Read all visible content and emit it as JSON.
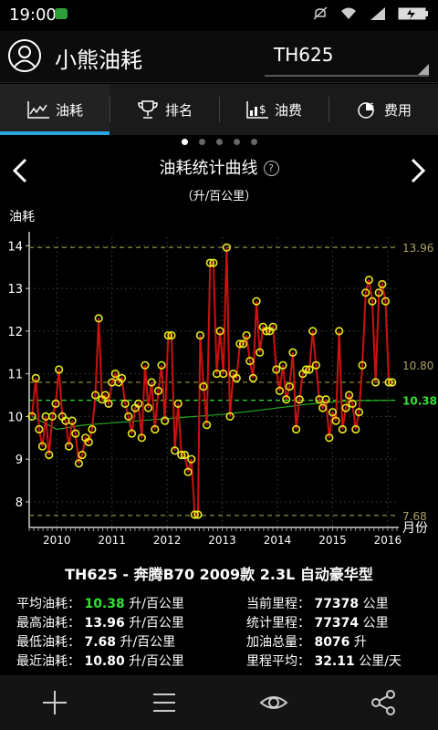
{
  "status": {
    "time": "19:00"
  },
  "app": {
    "title": "小熊油耗",
    "vehicle": "TH625"
  },
  "tabs": [
    {
      "label": "油耗",
      "icon": "consumption-chart-icon",
      "active": true
    },
    {
      "label": "排名",
      "icon": "trophy-icon",
      "active": false
    },
    {
      "label": "油费",
      "icon": "fuel-cost-icon",
      "active": false
    },
    {
      "label": "费用",
      "icon": "expense-pie-icon",
      "active": false
    }
  ],
  "pager": {
    "count": 5,
    "active": 0
  },
  "chart_header": {
    "title": "油耗统计曲线",
    "help": "?",
    "unit": "（升/百公里）"
  },
  "chart_data": {
    "type": "line",
    "ylabel": "油耗",
    "xlabel": "月份",
    "ylim": [
      7.4,
      14.2
    ],
    "yticks": [
      8,
      9,
      10,
      11,
      12,
      13,
      14
    ],
    "xlim": [
      2009.5,
      2016.2
    ],
    "xticks": [
      2010,
      2011,
      2012,
      2013,
      2014,
      2015,
      2016
    ],
    "reference_lines": [
      {
        "label": "13.96",
        "value": 13.96,
        "color": "#8a8a3a"
      },
      {
        "label": "10.80",
        "value": 10.8,
        "color": "#8a8a3a"
      },
      {
        "label": "10.38",
        "value": 10.38,
        "color": "#33e233"
      },
      {
        "label": "7.68",
        "value": 7.68,
        "color": "#8a8a3a"
      }
    ],
    "series": [
      {
        "role": "fuel-consumption",
        "color": "#cc1111",
        "marker_color": "#e8e81a",
        "x": [
          2009.55,
          2009.62,
          2009.68,
          2009.74,
          2009.8,
          2009.86,
          2009.92,
          2009.98,
          2010.04,
          2010.1,
          2010.16,
          2010.22,
          2010.28,
          2010.34,
          2010.4,
          2010.46,
          2010.52,
          2010.58,
          2010.64,
          2010.7,
          2010.76,
          2010.82,
          2010.88,
          2010.94,
          2011.0,
          2011.06,
          2011.12,
          2011.18,
          2011.24,
          2011.3,
          2011.36,
          2011.42,
          2011.48,
          2011.54,
          2011.6,
          2011.66,
          2011.72,
          2011.78,
          2011.84,
          2011.9,
          2011.96,
          2012.02,
          2012.08,
          2012.14,
          2012.2,
          2012.26,
          2012.32,
          2012.38,
          2012.44,
          2012.5,
          2012.56,
          2012.6,
          2012.66,
          2012.72,
          2012.78,
          2012.84,
          2012.9,
          2012.96,
          2013.02,
          2013.08,
          2013.14,
          2013.2,
          2013.26,
          2013.32,
          2013.38,
          2013.44,
          2013.5,
          2013.56,
          2013.62,
          2013.68,
          2013.74,
          2013.8,
          2013.86,
          2013.92,
          2013.98,
          2014.04,
          2014.1,
          2014.16,
          2014.22,
          2014.28,
          2014.34,
          2014.4,
          2014.46,
          2014.52,
          2014.58,
          2014.64,
          2014.7,
          2014.76,
          2014.82,
          2014.88,
          2014.94,
          2015.0,
          2015.06,
          2015.12,
          2015.18,
          2015.24,
          2015.3,
          2015.36,
          2015.42,
          2015.48,
          2015.54,
          2015.6,
          2015.66,
          2015.72,
          2015.78,
          2015.84,
          2015.9,
          2015.96,
          2016.02,
          2016.08
        ],
        "y": [
          10.0,
          10.9,
          9.7,
          9.3,
          10.0,
          9.1,
          10.0,
          10.3,
          11.1,
          10.0,
          9.9,
          9.3,
          9.9,
          9.6,
          8.9,
          9.1,
          9.5,
          9.4,
          9.7,
          10.5,
          12.3,
          10.4,
          10.5,
          10.3,
          10.8,
          11.0,
          10.8,
          10.9,
          10.3,
          10.0,
          9.6,
          10.2,
          10.3,
          9.5,
          11.2,
          10.2,
          10.8,
          9.7,
          10.6,
          11.2,
          9.9,
          11.9,
          11.9,
          9.2,
          10.3,
          9.1,
          9.1,
          8.7,
          9.0,
          7.7,
          7.7,
          11.9,
          10.7,
          9.8,
          13.6,
          13.6,
          11.0,
          12.0,
          11.0,
          13.96,
          10.0,
          11.0,
          10.9,
          11.7,
          11.7,
          11.9,
          11.3,
          10.9,
          12.7,
          11.5,
          12.1,
          12.0,
          12.0,
          12.1,
          11.1,
          10.6,
          11.2,
          10.4,
          10.7,
          11.5,
          9.7,
          10.4,
          11.0,
          11.1,
          11.1,
          12.0,
          11.2,
          10.4,
          10.2,
          10.4,
          9.5,
          10.1,
          9.9,
          12.0,
          9.7,
          10.2,
          10.5,
          10.3,
          9.7,
          10.1,
          11.2,
          12.9,
          13.2,
          12.7,
          10.8,
          12.9,
          13.1,
          12.7,
          10.8,
          10.8
        ]
      },
      {
        "role": "average-trend",
        "color": "#22aa22",
        "x": [
          2009.55,
          2010.0,
          2010.5,
          2011.0,
          2011.5,
          2012.0,
          2012.5,
          2013.0,
          2013.5,
          2014.0,
          2014.5,
          2015.0,
          2015.5,
          2016.08
        ],
        "y": [
          10.0,
          9.7,
          9.8,
          9.85,
          9.9,
          9.95,
          10.0,
          10.05,
          10.12,
          10.2,
          10.28,
          10.34,
          10.37,
          10.38
        ]
      }
    ]
  },
  "model": {
    "title": "TH625 - 奔腾B70 2009款 2.3L 自动豪华型"
  },
  "stats_left": [
    {
      "label": "平均油耗：",
      "value": "10.38",
      "unit": "升/百公里",
      "highlight": true
    },
    {
      "label": "最高油耗：",
      "value": "13.96",
      "unit": "升/百公里"
    },
    {
      "label": "最低油耗：",
      "value": "7.68",
      "unit": "升/百公里"
    },
    {
      "label": "最近油耗：",
      "value": "10.80",
      "unit": "升/百公里"
    }
  ],
  "stats_right": [
    {
      "label": "当前里程：",
      "value": "77378",
      "unit": "公里"
    },
    {
      "label": "统计里程：",
      "value": "77374",
      "unit": "公里"
    },
    {
      "label": "加油总量：",
      "value": "8076",
      "unit": "升"
    },
    {
      "label": "里程平均：",
      "value": "32.11",
      "unit": "公里/天"
    }
  ],
  "bottom_bar": [
    {
      "icon": "add-icon"
    },
    {
      "icon": "menu-icon"
    },
    {
      "icon": "eye-icon"
    },
    {
      "icon": "share-icon"
    }
  ]
}
